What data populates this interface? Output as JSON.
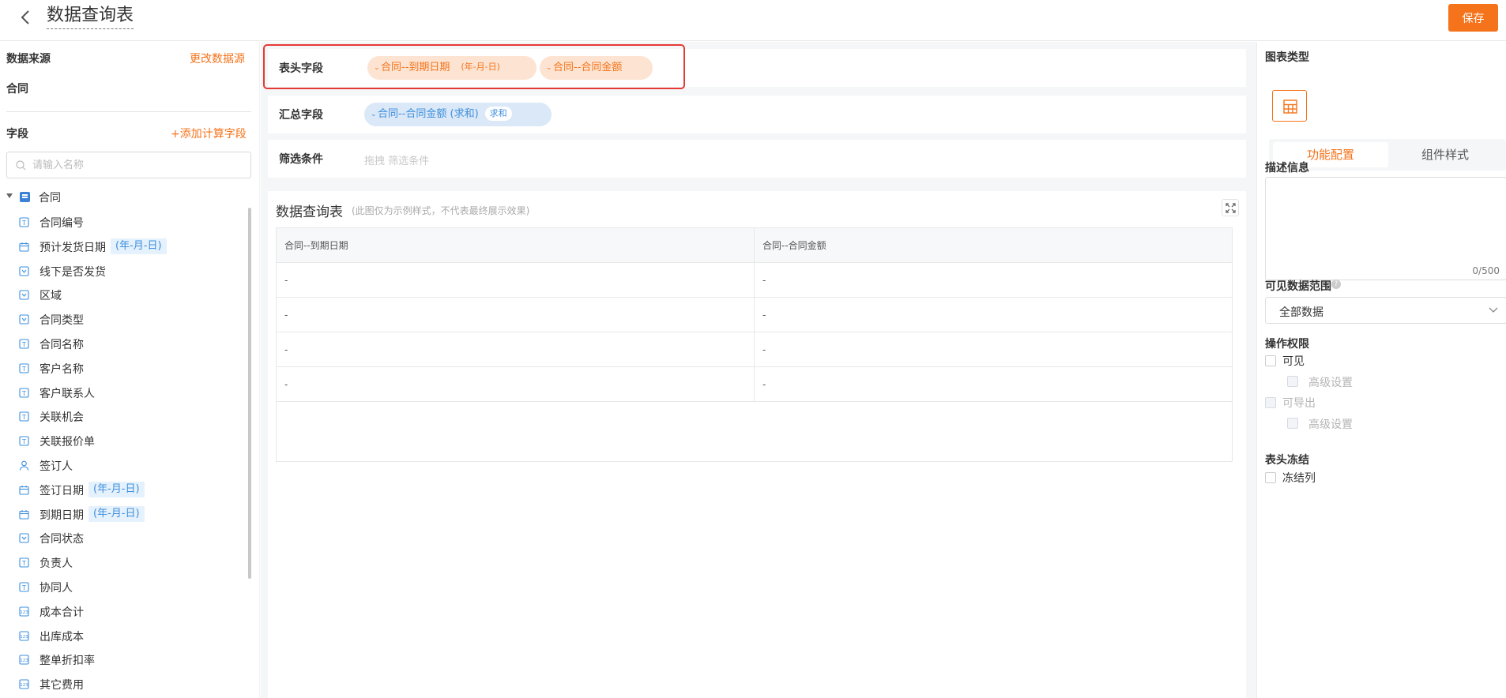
{
  "header": {
    "title": "数据查询表",
    "save_label": "保存"
  },
  "source": {
    "section_title": "数据来源",
    "change_link": "更改数据源",
    "value": "合同"
  },
  "fields_panel": {
    "section_title": "字段",
    "add_link": "+添加计算字段",
    "search_placeholder": "请输入名称",
    "root_label": "合同",
    "items": [
      {
        "label": "合同编号",
        "icon": "text-field-icon",
        "tag": ""
      },
      {
        "label": "预计发货日期",
        "icon": "calendar-icon",
        "tag": "(年-月-日)"
      },
      {
        "label": "线下是否发货",
        "icon": "dropdown-field-icon",
        "tag": ""
      },
      {
        "label": "区域",
        "icon": "dropdown-field-icon",
        "tag": ""
      },
      {
        "label": "合同类型",
        "icon": "dropdown-field-icon",
        "tag": ""
      },
      {
        "label": "合同名称",
        "icon": "text-field-icon",
        "tag": ""
      },
      {
        "label": "客户名称",
        "icon": "text-field-icon",
        "tag": ""
      },
      {
        "label": "客户联系人",
        "icon": "text-field-icon",
        "tag": ""
      },
      {
        "label": "关联机会",
        "icon": "text-field-icon",
        "tag": ""
      },
      {
        "label": "关联报价单",
        "icon": "text-field-icon",
        "tag": ""
      },
      {
        "label": "签订人",
        "icon": "user-icon",
        "tag": ""
      },
      {
        "label": "签订日期",
        "icon": "calendar-icon",
        "tag": "(年-月-日)"
      },
      {
        "label": "到期日期",
        "icon": "calendar-icon",
        "tag": "(年-月-日)"
      },
      {
        "label": "合同状态",
        "icon": "dropdown-field-icon",
        "tag": ""
      },
      {
        "label": "负责人",
        "icon": "text-field-icon",
        "tag": ""
      },
      {
        "label": "协同人",
        "icon": "text-field-icon",
        "tag": ""
      },
      {
        "label": "成本合计",
        "icon": "number-field-icon",
        "tag": ""
      },
      {
        "label": "出库成本",
        "icon": "number-field-icon",
        "tag": ""
      },
      {
        "label": "整单折扣率",
        "icon": "number-field-icon",
        "tag": ""
      },
      {
        "label": "其它费用",
        "icon": "number-field-icon",
        "tag": ""
      }
    ]
  },
  "config_rows": {
    "header_fields": {
      "label": "表头字段",
      "chips": [
        {
          "text": "合同--到期日期",
          "sub": "(年-月-日)"
        },
        {
          "text": "合同--合同金额",
          "sub": ""
        }
      ]
    },
    "summary_fields": {
      "label": "汇总字段",
      "chips": [
        {
          "text": "合同--合同金额 (求和)",
          "sub": "求和"
        }
      ]
    },
    "filter": {
      "label": "筛选条件",
      "placeholder": "拖拽 筛选条件"
    }
  },
  "preview": {
    "title": "数据查询表",
    "note": "(此图仅为示例样式，不代表最终展示效果)",
    "columns": [
      "合同--到期日期",
      "合同--合同金额"
    ],
    "rows": [
      [
        "-",
        "-"
      ],
      [
        "-",
        "-"
      ],
      [
        "-",
        "-"
      ],
      [
        "-",
        "-"
      ]
    ]
  },
  "settings": {
    "chart_type_title": "图表类型",
    "chart_type_icon": "table-icon",
    "tabs": [
      "功能配置",
      "组件样式"
    ],
    "description_title": "描述信息",
    "description_counter": "0/500",
    "visible_range_title": "可见数据范围",
    "visible_range_value": "全部数据",
    "permissions_title": "操作权限",
    "perm_visible": "可见",
    "perm_visible_advanced": "高级设置",
    "perm_export": "可导出",
    "perm_export_advanced": "高级设置",
    "freeze_title": "表头冻结",
    "freeze_column": "冻结列"
  },
  "colors": {
    "accent": "#f5731b",
    "blue": "#3d8fdd",
    "highlight": "#e53935"
  }
}
